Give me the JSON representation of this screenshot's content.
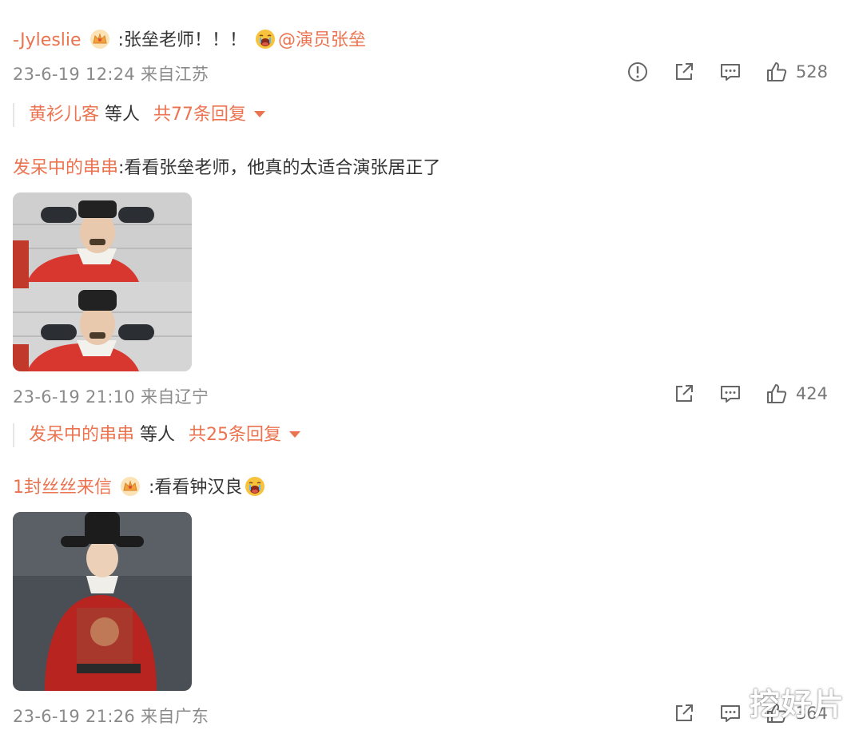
{
  "comments": [
    {
      "username": "-Jyleslie",
      "text": ":张垒老师！！！",
      "mention": "@演员张垒",
      "meta": "23-6-19 12:24 来自江苏",
      "likes": "528",
      "replies": {
        "user": "黄衫儿客",
        "suffix": "等人",
        "total": "共77条回复"
      }
    },
    {
      "username": "发呆中的串串",
      "text": ":看看张垒老师，他真的太适合演张居正了",
      "meta": "23-6-19 21:10 来自辽宁",
      "likes": "424",
      "replies": {
        "user": "发呆中的串串",
        "suffix": "等人",
        "total": "共25条回复"
      }
    },
    {
      "username": "1封丝丝来信",
      "text": ":看看钟汉良",
      "meta": "23-6-19 21:26 来自广东",
      "likes": "364"
    }
  ],
  "icons": {
    "report": "exclamation-circle-icon",
    "share": "share-icon",
    "comment": "comment-icon",
    "like": "thumbs-up-icon",
    "expand": "chevron-down-icon",
    "vip": "crown-icon",
    "emoji": "cry-face-icon"
  },
  "colors": {
    "username": "#eb7350",
    "meta": "#8a8a8a",
    "text": "#333333"
  },
  "watermark": "挖好片"
}
